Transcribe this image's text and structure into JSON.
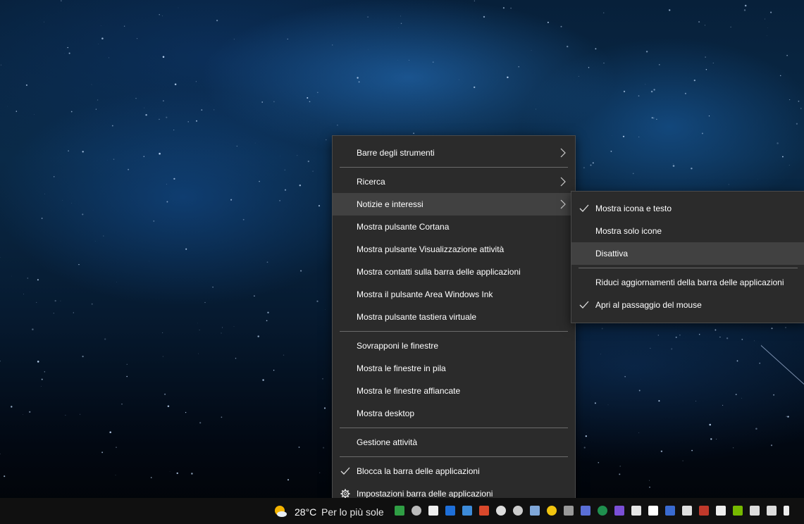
{
  "main_menu": {
    "items": [
      {
        "label": "Barre degli strumenti",
        "submenu": true
      },
      {
        "label": "Ricerca",
        "submenu": true
      },
      {
        "label": "Notizie e interessi",
        "submenu": true,
        "highlighted": true
      },
      {
        "label": "Mostra pulsante Cortana"
      },
      {
        "label": "Mostra pulsante Visualizzazione attività"
      },
      {
        "label": "Mostra contatti sulla barra delle applicazioni"
      },
      {
        "label": "Mostra il pulsante Area Windows Ink"
      },
      {
        "label": "Mostra pulsante tastiera virtuale"
      },
      {
        "label": "Sovrapponi le finestre"
      },
      {
        "label": "Mostra le finestre in pila"
      },
      {
        "label": "Mostra le finestre affiancate"
      },
      {
        "label": "Mostra desktop"
      },
      {
        "label": "Gestione attività"
      },
      {
        "label": "Blocca la barra delle applicazioni",
        "checked": true
      },
      {
        "label": "Impostazioni barra delle applicazioni",
        "icon": "gear-icon"
      }
    ]
  },
  "sub_menu": {
    "items": [
      {
        "label": "Mostra icona e testo",
        "checked": true
      },
      {
        "label": "Mostra solo icone"
      },
      {
        "label": "Disattiva",
        "highlighted": true
      },
      {
        "label": "Riduci aggiornamenti della barra delle applicazioni"
      },
      {
        "label": "Apri al passaggio del mouse",
        "checked": true
      }
    ]
  },
  "taskbar": {
    "weather_icon": "partly-sunny-icon",
    "temperature": "28°C",
    "news_text": "Per lo più sole"
  },
  "colors": {
    "menu_bg": "#2b2b2b",
    "menu_highlight": "#414141",
    "separator": "#6b6b6b",
    "taskbar_bg": "#101010"
  }
}
